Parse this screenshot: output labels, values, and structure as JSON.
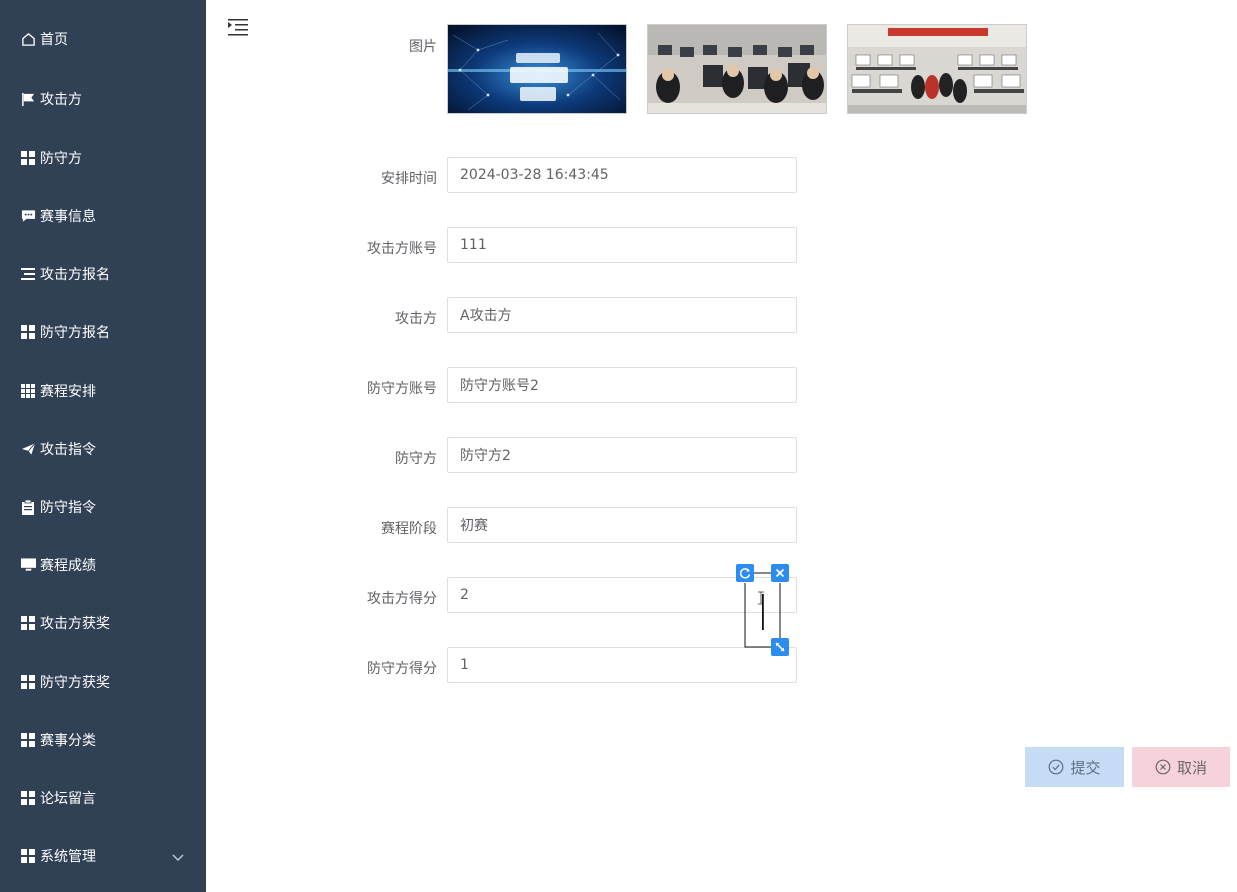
{
  "sidebar": {
    "items": [
      {
        "label": "首页",
        "icon": "home-icon"
      },
      {
        "label": "攻击方",
        "icon": "flag-icon"
      },
      {
        "label": "防守方",
        "icon": "grid-icon"
      },
      {
        "label": "赛事信息",
        "icon": "chat-icon"
      },
      {
        "label": "攻击方报名",
        "icon": "list-icon"
      },
      {
        "label": "防守方报名",
        "icon": "grid-icon"
      },
      {
        "label": "赛程安排",
        "icon": "table-icon"
      },
      {
        "label": "攻击指令",
        "icon": "send-icon"
      },
      {
        "label": "防守指令",
        "icon": "clipboard-icon"
      },
      {
        "label": "赛程成绩",
        "icon": "monitor-icon"
      },
      {
        "label": "攻击方获奖",
        "icon": "grid-icon"
      },
      {
        "label": "防守方获奖",
        "icon": "grid-icon"
      },
      {
        "label": "赛事分类",
        "icon": "grid-icon"
      },
      {
        "label": "论坛留言",
        "icon": "grid-icon"
      },
      {
        "label": "系统管理",
        "icon": "grid-icon"
      }
    ]
  },
  "form": {
    "image_label": "图片",
    "fields": [
      {
        "label": "安排时间",
        "value": "2024-03-28 16:43:45"
      },
      {
        "label": "攻击方账号",
        "value": "111"
      },
      {
        "label": "攻击方",
        "value": "A攻击方"
      },
      {
        "label": "防守方账号",
        "value": "防守方账号2"
      },
      {
        "label": "防守方",
        "value": "防守方2"
      },
      {
        "label": "赛程阶段",
        "value": "初赛"
      },
      {
        "label": "攻击方得分",
        "value": "2"
      },
      {
        "label": "防守方得分",
        "value": "1"
      }
    ]
  },
  "actions": {
    "submit_label": "提交",
    "cancel_label": "取消"
  },
  "colors": {
    "sidebar_bg": "#304156",
    "accent": "#2d8cf0",
    "submit_bg": "#c6dbf4",
    "cancel_bg": "#f6d3da"
  }
}
